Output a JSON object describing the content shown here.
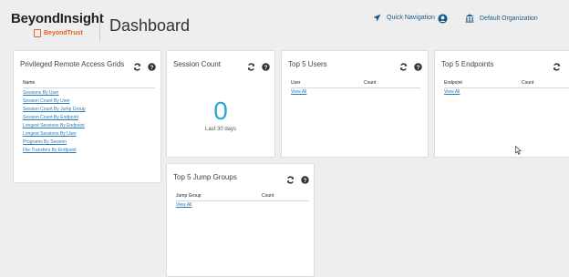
{
  "header": {
    "brand": "BeyondInsight",
    "brand_sub": "BeyondTrust",
    "title": "Dashboard",
    "quick_nav": "Quick Navigation",
    "org": "Default Organization"
  },
  "cards": {
    "grids": {
      "title": "Privileged Remote Access Grids",
      "column": "Name",
      "links": [
        "Sessions By User",
        "Session Count By User",
        "Session Count By Jump Group",
        "Session Count By Endpoint",
        "Longest Sessions By Endpoint",
        "Longest Sessions By User",
        "Programs By Session",
        "File Transfers By Endpoint"
      ]
    },
    "session_count": {
      "title": "Session Count",
      "value": "0",
      "period": "Last 30 days"
    },
    "top_users": {
      "title": "Top 5 Users",
      "col1": "User",
      "col2": "Count",
      "view_all": "View All"
    },
    "top_endpoints": {
      "title": "Top 5 Endpoints",
      "col1": "Endpoint",
      "col2": "Count",
      "view_all": "View All"
    },
    "top_jump_groups": {
      "title": "Top 5 Jump Groups",
      "col1": "Jump Group",
      "col2": "Count",
      "view_all": "View All"
    }
  },
  "icons": {
    "refresh": "refresh-icon",
    "help": "help-icon"
  },
  "colors": {
    "accent": "#29a8d6",
    "link": "#2a7ab8",
    "brand_orange": "#e0632a"
  }
}
